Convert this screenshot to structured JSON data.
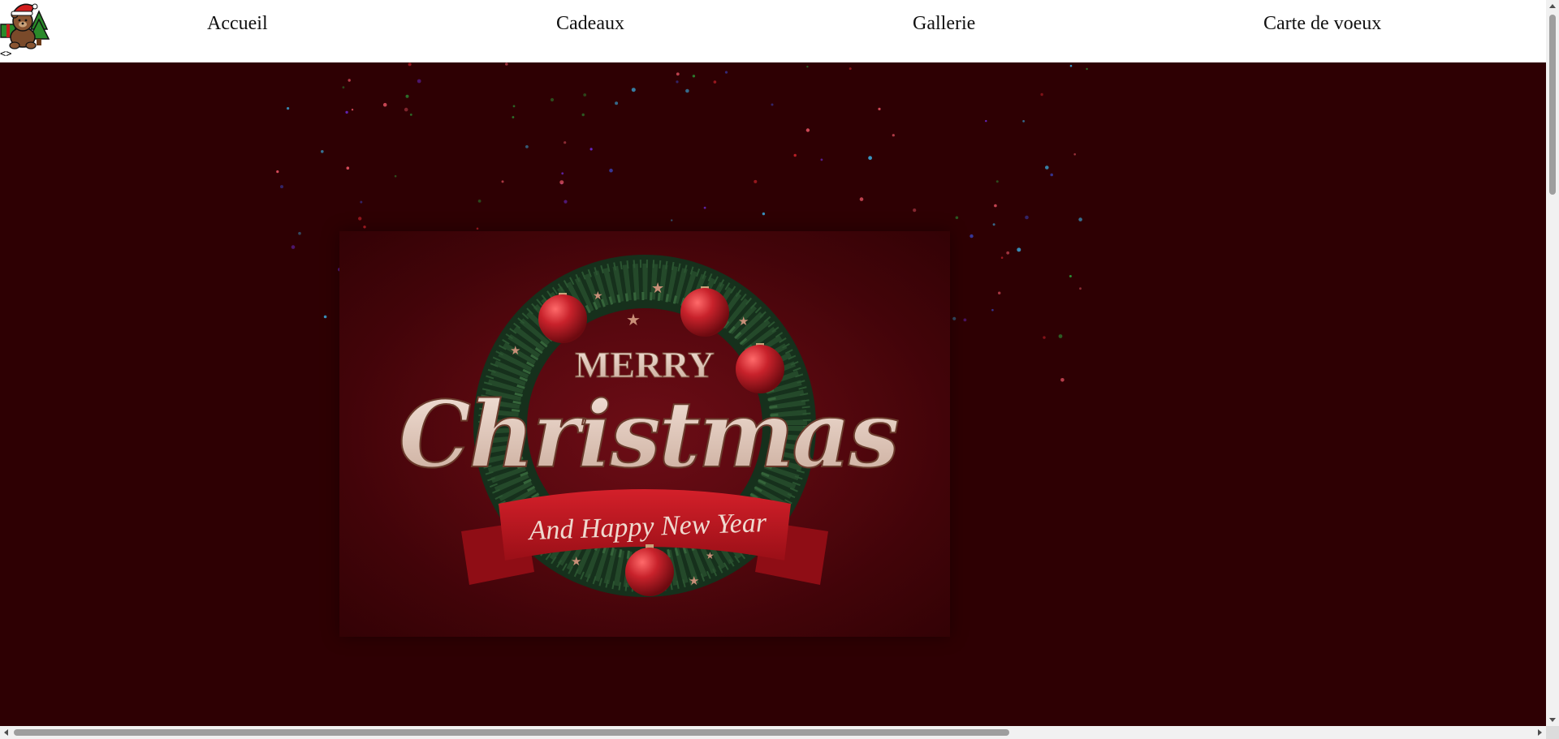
{
  "nav": {
    "logo_alt": "teddy-bear-with-santa-hat",
    "code_glyph": "<>",
    "items": [
      "Accueil",
      "Cadeaux",
      "Gallerie",
      "Carte de voeux"
    ]
  },
  "card": {
    "line1": "MERRY",
    "line2": "Christmas",
    "line3": "And Happy New Year"
  },
  "colors": {
    "background": "#2e0003",
    "ribbon": "#c2161f",
    "ornament": "#c8222b",
    "lettering": "#e9d3c8"
  }
}
